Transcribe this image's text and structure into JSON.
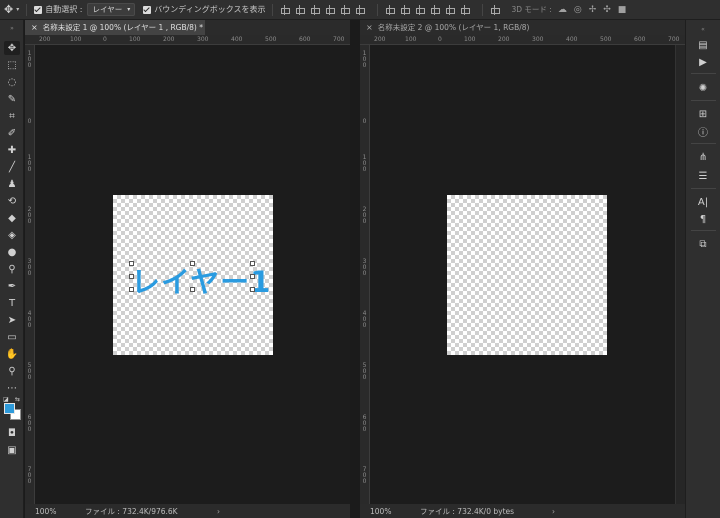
{
  "options_bar": {
    "move_icon": "move-icon",
    "auto_select_label": "自動選択 :",
    "auto_select_value": "レイヤー",
    "show_bounding_box_label": "バウンディングボックスを表示",
    "mode_3d_label": "3D モード :"
  },
  "documents": [
    {
      "tab_title": "名称未設定 1 @ 100% (レイヤー 1 , RGB/8) *",
      "ruler_marks": [
        "200",
        "100",
        "0",
        "100",
        "200",
        "300",
        "400",
        "500",
        "600",
        "700"
      ],
      "vruler_marks": [
        "1\n0\n0",
        "0",
        "1\n0\n0",
        "2\n0\n0",
        "3\n0\n0",
        "4\n0\n0",
        "5\n0\n0",
        "6\n0\n0",
        "7\n0\n0"
      ],
      "layer_text": "レイヤー1",
      "text_color": "#2a9be0",
      "zoom": "100%",
      "file_info": "ファイル : 732.4K/976.6K",
      "arrow": "›"
    },
    {
      "tab_title": "名称未設定 2 @ 100% (レイヤー 1, RGB/8)",
      "ruler_marks": [
        "200",
        "100",
        "0",
        "100",
        "200",
        "300",
        "400",
        "500",
        "600",
        "700"
      ],
      "vruler_marks": [
        "1\n0\n0",
        "0",
        "1\n0\n0",
        "2\n0\n0",
        "3\n0\n0",
        "4\n0\n0",
        "5\n0\n0",
        "6\n0\n0",
        "7\n0\n0"
      ],
      "zoom": "100%",
      "file_info": "ファイル : 732.4K/0 bytes",
      "arrow": "›"
    }
  ],
  "colors": {
    "foreground": "#2e9bdb",
    "background": "#ffffff"
  }
}
